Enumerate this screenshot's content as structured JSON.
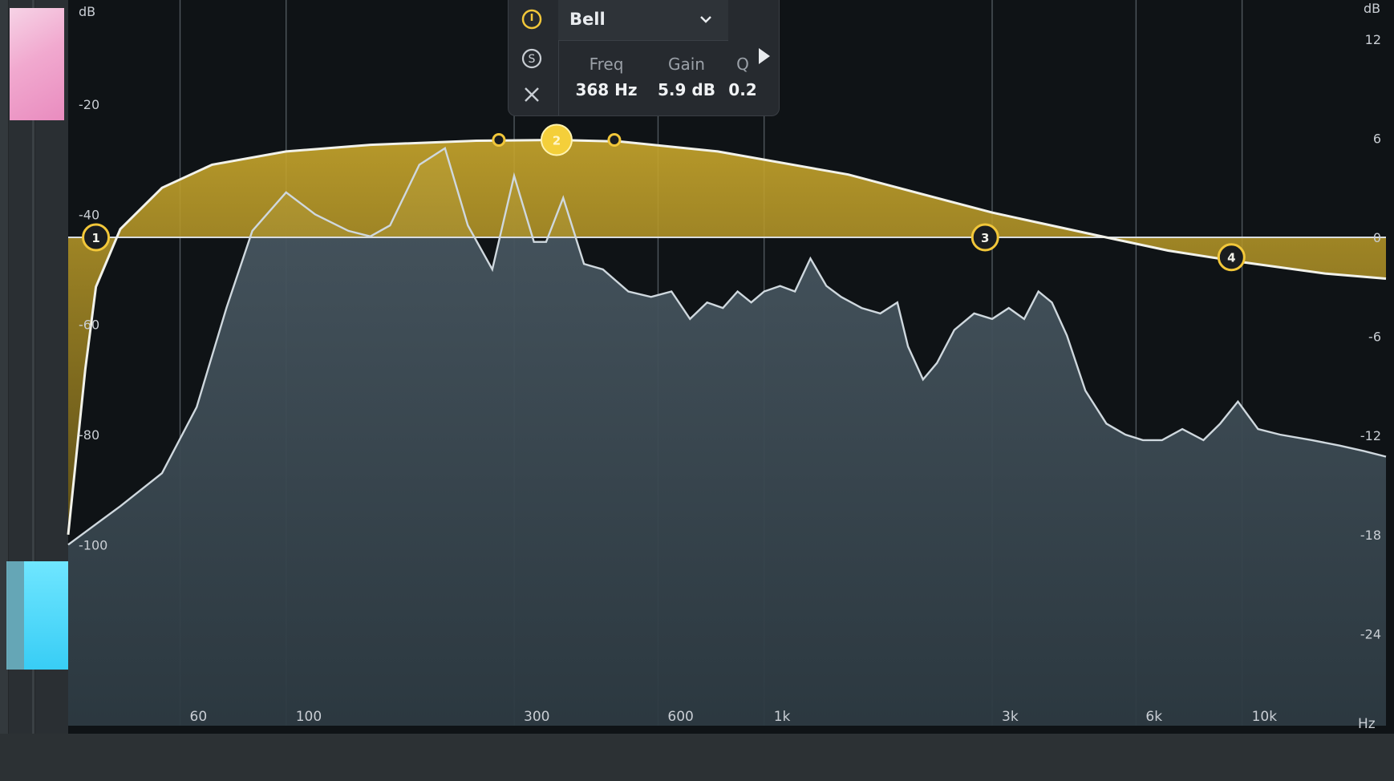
{
  "app": {
    "db_axis_left_title": "dB",
    "db_axis_right_title": "dB",
    "hz_unit": "Hz"
  },
  "left_db_ticks": [
    {
      "label": "-20",
      "value": -20
    },
    {
      "label": "-40",
      "value": -40
    },
    {
      "label": "-60",
      "value": -60
    },
    {
      "label": "-80",
      "value": -80
    },
    {
      "label": "-100",
      "value": -100
    }
  ],
  "right_db_ticks": [
    {
      "label": "12",
      "value": 12
    },
    {
      "label": "6",
      "value": 6
    },
    {
      "label": "0",
      "value": 0
    },
    {
      "label": "-6",
      "value": -6
    },
    {
      "label": "-12",
      "value": -12
    },
    {
      "label": "-18",
      "value": -18
    },
    {
      "label": "-24",
      "value": -24
    }
  ],
  "freq_ticks": [
    {
      "label": "60",
      "hz": 60
    },
    {
      "label": "100",
      "hz": 100
    },
    {
      "label": "300",
      "hz": 300
    },
    {
      "label": "600",
      "hz": 600
    },
    {
      "label": "1k",
      "hz": 1000
    },
    {
      "label": "3k",
      "hz": 3000
    },
    {
      "label": "6k",
      "hz": 6000
    },
    {
      "label": "10k",
      "hz": 10000
    }
  ],
  "eq_bands": [
    {
      "id": "1",
      "freq_hz": 40,
      "gain_db": 0
    },
    {
      "id": "2",
      "freq_hz": 368,
      "gain_db": 5.9,
      "selected": true
    },
    {
      "id": "3",
      "freq_hz": 2900,
      "gain_db": 0
    },
    {
      "id": "4",
      "freq_hz": 9500,
      "gain_db": -1.2
    }
  ],
  "popup": {
    "filter_type": "Bell",
    "freq_label": "Freq",
    "freq_value": "368 Hz",
    "gain_label": "Gain",
    "gain_value": "5.9 dB",
    "q_label": "Q",
    "q_value": "0.2"
  },
  "colors": {
    "eq_fill": "#b29526",
    "eq_line": "#f2f2ea",
    "band_ring": "#f2c73a",
    "spectrum_line": "#cfd8de",
    "spectrum_fill": "#3d4c55",
    "background": "#0f1316"
  },
  "chart_data": {
    "type": "area",
    "x_scale": "log",
    "x_unit": "Hz",
    "xlim": [
      35,
      20000
    ],
    "spectrum_ylim_db": [
      -110,
      -20
    ],
    "eq_ylim_db": [
      -27,
      13
    ],
    "spectrum_db": [
      [
        35,
        -100
      ],
      [
        45,
        -93
      ],
      [
        55,
        -87
      ],
      [
        65,
        -75
      ],
      [
        75,
        -57
      ],
      [
        85,
        -43
      ],
      [
        100,
        -36
      ],
      [
        115,
        -40
      ],
      [
        135,
        -43
      ],
      [
        150,
        -44
      ],
      [
        165,
        -42
      ],
      [
        190,
        -31
      ],
      [
        215,
        -28
      ],
      [
        240,
        -42
      ],
      [
        270,
        -50
      ],
      [
        300,
        -33
      ],
      [
        330,
        -45
      ],
      [
        350,
        -45
      ],
      [
        380,
        -37
      ],
      [
        420,
        -49
      ],
      [
        460,
        -50
      ],
      [
        520,
        -54
      ],
      [
        580,
        -55
      ],
      [
        640,
        -54
      ],
      [
        700,
        -59
      ],
      [
        760,
        -56
      ],
      [
        820,
        -57
      ],
      [
        880,
        -54
      ],
      [
        940,
        -56
      ],
      [
        1000,
        -54
      ],
      [
        1080,
        -53
      ],
      [
        1160,
        -54
      ],
      [
        1250,
        -48
      ],
      [
        1350,
        -53
      ],
      [
        1450,
        -55
      ],
      [
        1600,
        -57
      ],
      [
        1750,
        -58
      ],
      [
        1900,
        -56
      ],
      [
        2000,
        -64
      ],
      [
        2150,
        -70
      ],
      [
        2300,
        -67
      ],
      [
        2500,
        -61
      ],
      [
        2750,
        -58
      ],
      [
        3000,
        -59
      ],
      [
        3250,
        -57
      ],
      [
        3500,
        -59
      ],
      [
        3750,
        -54
      ],
      [
        4000,
        -56
      ],
      [
        4300,
        -62
      ],
      [
        4700,
        -72
      ],
      [
        5200,
        -78
      ],
      [
        5700,
        -80
      ],
      [
        6200,
        -81
      ],
      [
        6800,
        -81
      ],
      [
        7500,
        -79
      ],
      [
        8300,
        -81
      ],
      [
        9000,
        -78
      ],
      [
        9800,
        -74
      ],
      [
        10800,
        -79
      ],
      [
        12000,
        -80
      ],
      [
        14000,
        -81
      ],
      [
        16000,
        -82
      ],
      [
        18000,
        -83
      ],
      [
        20000,
        -84
      ]
    ],
    "eq_curve_db": [
      [
        35,
        -18
      ],
      [
        38,
        -8
      ],
      [
        40,
        -3
      ],
      [
        45,
        0.5
      ],
      [
        55,
        3
      ],
      [
        70,
        4.4
      ],
      [
        100,
        5.2
      ],
      [
        150,
        5.6
      ],
      [
        250,
        5.85
      ],
      [
        368,
        5.9
      ],
      [
        500,
        5.8
      ],
      [
        800,
        5.2
      ],
      [
        1500,
        3.8
      ],
      [
        3000,
        1.5
      ],
      [
        5000,
        0.1
      ],
      [
        7000,
        -0.8
      ],
      [
        10000,
        -1.5
      ],
      [
        15000,
        -2.2
      ],
      [
        20000,
        -2.5
      ]
    ]
  }
}
